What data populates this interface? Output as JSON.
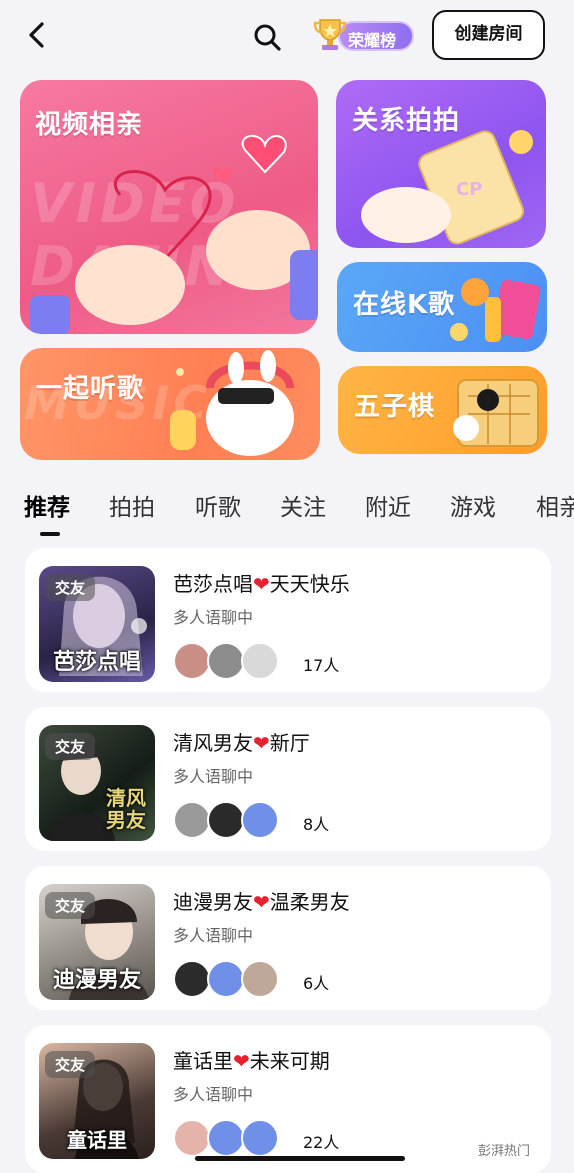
{
  "topbar": {
    "back_icon": "chevron-left-icon",
    "search_icon": "search-icon",
    "rank_label": "荣耀榜",
    "create_label": "创建房间"
  },
  "features": {
    "video": {
      "title": "视频相亲",
      "ghost": "VIDEO DATING"
    },
    "photo": {
      "title": "关系拍拍"
    },
    "ksong": {
      "title": "在线K歌"
    },
    "music": {
      "title": "一起听歌",
      "ghost": "MUSIC"
    },
    "gomoku": {
      "title": "五子棋"
    }
  },
  "tabs": [
    "推荐",
    "拍拍",
    "听歌",
    "关注",
    "附近",
    "游戏",
    "相亲"
  ],
  "active_tab": 0,
  "rooms": [
    {
      "badge": "交友",
      "cover_text": "芭莎点唱",
      "title_a": "芭莎点唱",
      "title_b": "天天快乐",
      "subtitle": "多人语聊中",
      "count": "17人"
    },
    {
      "badge": "交友",
      "cover_text": "清风男友",
      "title_a": "清风男友",
      "title_b": "新厅",
      "subtitle": "多人语聊中",
      "count": "8人"
    },
    {
      "badge": "交友",
      "cover_text": "迪漫男友",
      "title_a": "迪漫男友",
      "title_b": "温柔男友",
      "subtitle": "多人语聊中",
      "count": "6人"
    },
    {
      "badge": "交友",
      "cover_text": "童话里",
      "title_a": "童话里",
      "title_b": "未来可期",
      "subtitle": "多人语聊中",
      "count": "22人"
    }
  ],
  "heart_glyph": "❤",
  "watermark": "彭湃热门",
  "colors": {
    "accent": "#111111",
    "heart": "#e5222d"
  }
}
